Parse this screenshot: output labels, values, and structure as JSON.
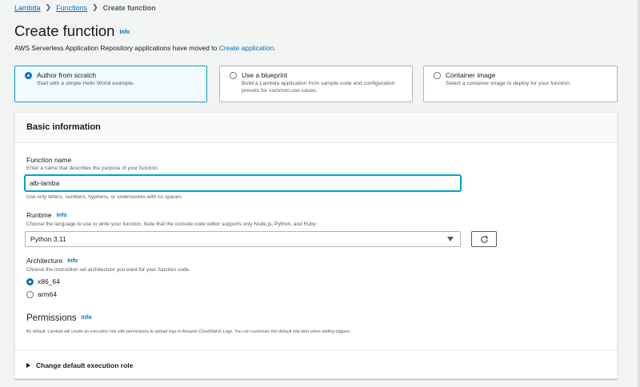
{
  "breadcrumb": {
    "items": [
      "Lambda",
      "Functions"
    ],
    "current": "Create function"
  },
  "header": {
    "title": "Create function",
    "info_label": "Info",
    "subtitle_prefix": "AWS Serverless Application Repository applications have moved to",
    "subtitle_link": "Create application",
    "subtitle_suffix": "."
  },
  "options": [
    {
      "title": "Author from scratch",
      "desc": "Start with a simple Hello World example.",
      "selected": true
    },
    {
      "title": "Use a blueprint",
      "desc": "Build a Lambda application from sample code and configuration presets for common use cases.",
      "selected": false
    },
    {
      "title": "Container image",
      "desc": "Select a container image to deploy for your function.",
      "selected": false
    }
  ],
  "basic_info": {
    "title": "Basic information",
    "function_name": {
      "label": "Function name",
      "desc": "Enter a name that describes the purpose of your function.",
      "value": "alb-lamba",
      "constraint": "Use only letters, numbers, hyphens, or underscores with no spaces."
    },
    "runtime": {
      "label": "Runtime",
      "info": "Info",
      "desc": "Choose the language to use to write your function. Note that the console code editor supports only Node.js, Python, and Ruby.",
      "selected": "Python 3.11"
    },
    "architecture": {
      "label": "Architecture",
      "info": "Info",
      "desc": "Choose the instruction set architecture you want for your function code.",
      "options": [
        "x86_64",
        "arm64"
      ],
      "selected": "x86_64"
    },
    "permissions": {
      "title": "Permissions",
      "info": "Info",
      "desc": "By default, Lambda will create an execution role with permissions to upload logs to Amazon CloudWatch Logs. You can customize this default role later when adding triggers."
    },
    "expander_label": "Change default execution role"
  },
  "colors": {
    "accent": "#0073bb",
    "selected_border": "#00a1c9",
    "selected_bg": "#f1faff"
  }
}
